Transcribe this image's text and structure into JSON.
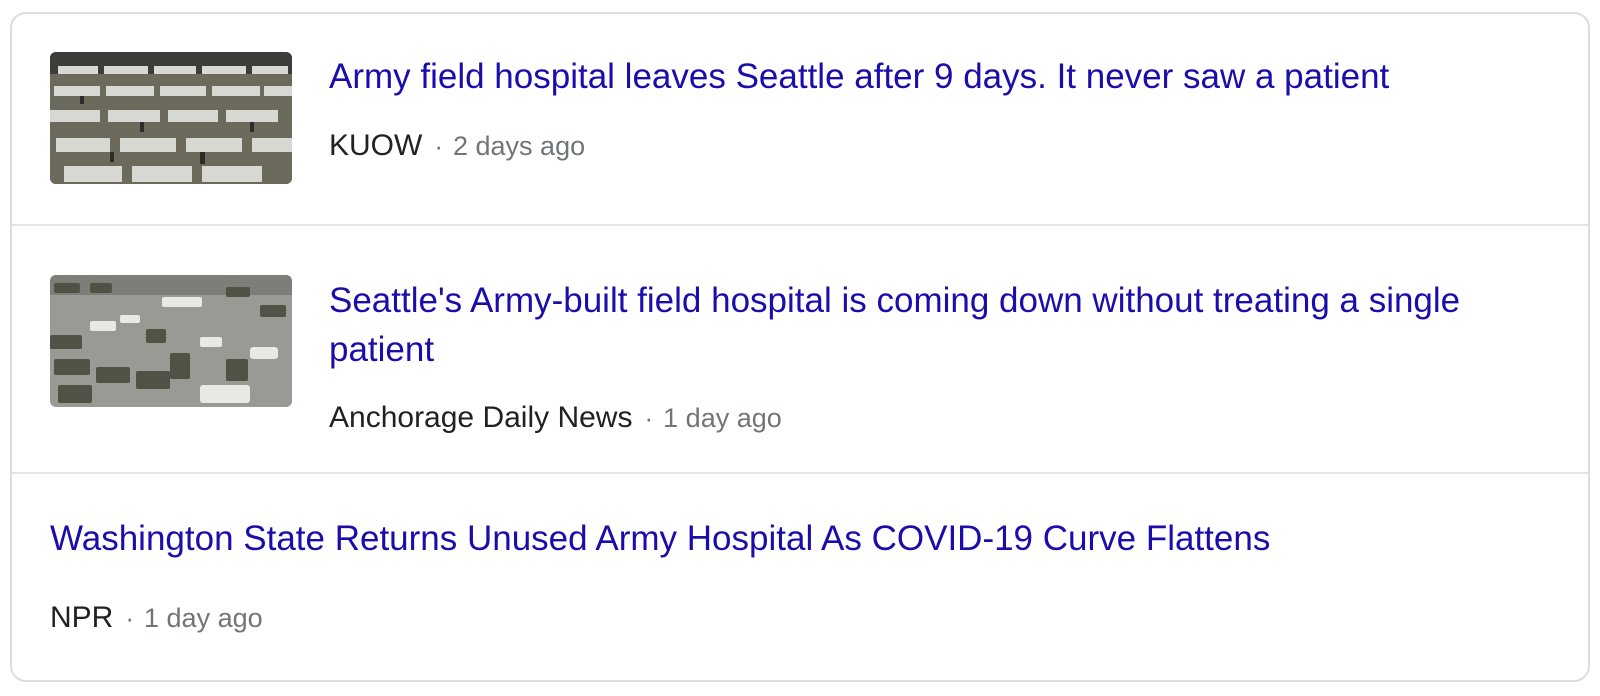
{
  "articles": [
    {
      "title": "Army field hospital leaves Seattle after 9 days. It never saw a patient",
      "source": "KUOW",
      "separator": "·",
      "time": "2 days ago",
      "thumbnail": "field-hospital-cubicles-photo"
    },
    {
      "title": "Seattle's Army-built field hospital is coming down without treating a single patient",
      "source": "Anchorage Daily News",
      "separator": "·",
      "time": "1 day ago",
      "thumbnail": "army-vehicles-parking-lot-photo"
    },
    {
      "title": "Washington State Returns Unused Army Hospital As COVID-19 Curve Flattens",
      "source": "NPR",
      "separator": "·",
      "time": "1 day ago"
    }
  ],
  "colors": {
    "title_link": "#1a0dab",
    "source_text": "#202124",
    "time_text": "#70757a",
    "border": "#dadce0"
  }
}
